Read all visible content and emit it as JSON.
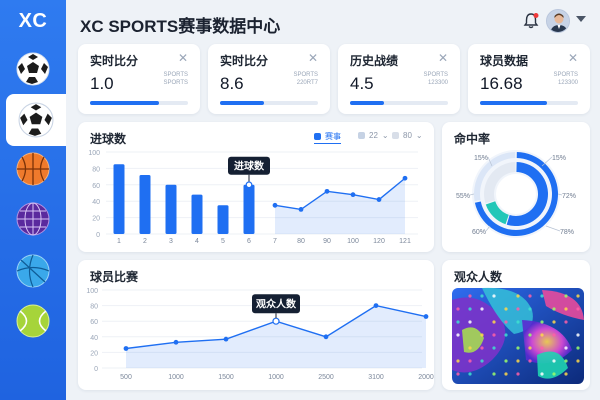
{
  "app": {
    "logo": "XC",
    "title": "XC SPORTS赛事数据中心"
  },
  "sidebar": {
    "items": [
      {
        "name": "football"
      },
      {
        "name": "football-active"
      },
      {
        "name": "basketball"
      },
      {
        "name": "globe-ball"
      },
      {
        "name": "volleyball"
      },
      {
        "name": "tennis"
      }
    ]
  },
  "stats": [
    {
      "title": "实时比分",
      "value": "1.0",
      "meta1": "SPORTS",
      "meta2": "SPORTS",
      "progress": 0.7
    },
    {
      "title": "实时比分",
      "value": "8.6",
      "meta1": "SPORTS",
      "meta2": "220RT7",
      "progress": 0.45
    },
    {
      "title": "历史战绩",
      "value": "4.5",
      "meta1": "SPORTS",
      "meta2": "123300",
      "progress": 0.35
    },
    {
      "title": "球员数据",
      "value": "16.68",
      "meta1": "SPORTS",
      "meta2": "123300",
      "progress": 0.68
    }
  ],
  "goals": {
    "title": "进球数",
    "legend": [
      "赛事",
      "22",
      "80"
    ],
    "tooltip": "进球数",
    "chart_data": {
      "type": "bar",
      "categories": [
        "1",
        "2",
        "3",
        "4",
        "5",
        "6",
        "7",
        "80",
        "90",
        "100",
        "120",
        "121"
      ],
      "bars": [
        85,
        72,
        60,
        48,
        35,
        60
      ],
      "line": [
        null,
        null,
        null,
        null,
        null,
        null,
        35,
        30,
        52,
        48,
        42,
        68
      ],
      "yticks": [
        "100",
        "80",
        "60",
        "40",
        "20",
        "0"
      ],
      "ylim": [
        0,
        100
      ]
    }
  },
  "hit_rate": {
    "title": "命中率",
    "labels": {
      "tl": "15%",
      "tr": "15%",
      "ml": "55%",
      "mr": "72%",
      "bl": "60%",
      "br": "78%"
    },
    "chart_data": {
      "type": "pie",
      "rings": [
        {
          "name": "outer",
          "values": [
            0.72,
            0.28
          ]
        },
        {
          "name": "inner",
          "values": [
            0.55,
            0.15,
            0.3
          ]
        }
      ]
    }
  },
  "player": {
    "title": "球员比赛",
    "tooltip": "观众人数",
    "chart_data": {
      "type": "area",
      "x": [
        "500",
        "1000",
        "1500",
        "1000",
        "2500",
        "3100",
        "2000"
      ],
      "values": [
        25,
        33,
        37,
        60,
        40,
        80,
        66
      ],
      "yticks": [
        "100",
        "80",
        "60",
        "40",
        "20",
        "0"
      ],
      "ylim": [
        0,
        100
      ]
    }
  },
  "audience": {
    "title": "观众人数"
  },
  "colors": {
    "accent": "#1f6ff2",
    "teal": "#22c7b8",
    "sidebar": "#2a73ea"
  }
}
